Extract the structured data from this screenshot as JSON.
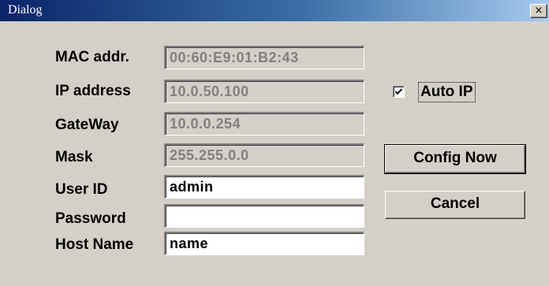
{
  "window": {
    "title": "Dialog",
    "close_label": "×"
  },
  "form": {
    "mac": {
      "label": "MAC addr.",
      "value": "00:60:E9:01:B2:43"
    },
    "ip": {
      "label": "IP address",
      "value": "10.0.50.100"
    },
    "gateway": {
      "label": "GateWay",
      "value": "10.0.0.254"
    },
    "mask": {
      "label": "Mask",
      "value": "255.255.0.0"
    },
    "user_id": {
      "label": "User ID",
      "value": "admin"
    },
    "password": {
      "label": "Password",
      "value": ""
    },
    "host_name": {
      "label": "Host Name",
      "value": "name"
    }
  },
  "auto_ip": {
    "label": "Auto IP",
    "checked": true
  },
  "buttons": {
    "config_now": "Config Now",
    "cancel": "Cancel"
  },
  "colors": {
    "face": "#d4d0c8",
    "title_start": "#0a246a",
    "title_end": "#a6caf0",
    "disabled_text": "#808080"
  }
}
